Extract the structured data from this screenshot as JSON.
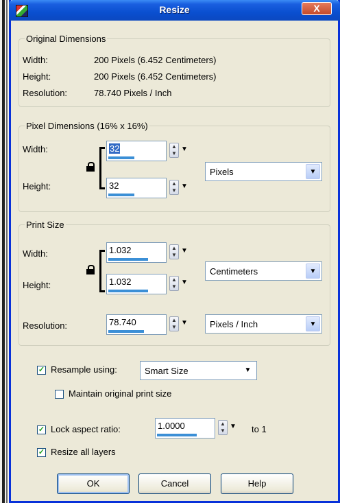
{
  "window": {
    "title": "Resize",
    "close_label": "X"
  },
  "original": {
    "legend": "Original Dimensions",
    "width_label": "Width:",
    "width_value": "200 Pixels (6.452 Centimeters)",
    "height_label": "Height:",
    "height_value": "200 Pixels (6.452 Centimeters)",
    "resolution_label": "Resolution:",
    "resolution_value": "78.740 Pixels / Inch"
  },
  "pixel_dimensions": {
    "legend": "Pixel Dimensions (16% x 16%)",
    "width_label": "Width:",
    "width_value": "32",
    "height_label": "Height:",
    "height_value": "32",
    "unit": "Pixels"
  },
  "print_size": {
    "legend": "Print Size",
    "width_label": "Width:",
    "width_value": "1.032",
    "height_label": "Height:",
    "height_value": "1.032",
    "unit": "Centimeters",
    "resolution_label": "Resolution:",
    "resolution_value": "78.740",
    "resolution_unit": "Pixels / Inch"
  },
  "options": {
    "resample_label": "Resample using:",
    "resample_checked": true,
    "resample_method": "Smart Size",
    "maintain_label": "Maintain original print size",
    "maintain_checked": false,
    "lock_label": "Lock aspect ratio:",
    "lock_checked": true,
    "lock_value": "1.0000",
    "to_one": "to 1",
    "all_layers_label": "Resize all layers",
    "all_layers_checked": true
  },
  "buttons": {
    "ok": "OK",
    "cancel": "Cancel",
    "help": "Help"
  },
  "colors": {
    "title_bar": "#0a4fd0",
    "dialog_bg": "#ece9d8",
    "accent": "#3b8fd6",
    "check": "#21a121"
  }
}
